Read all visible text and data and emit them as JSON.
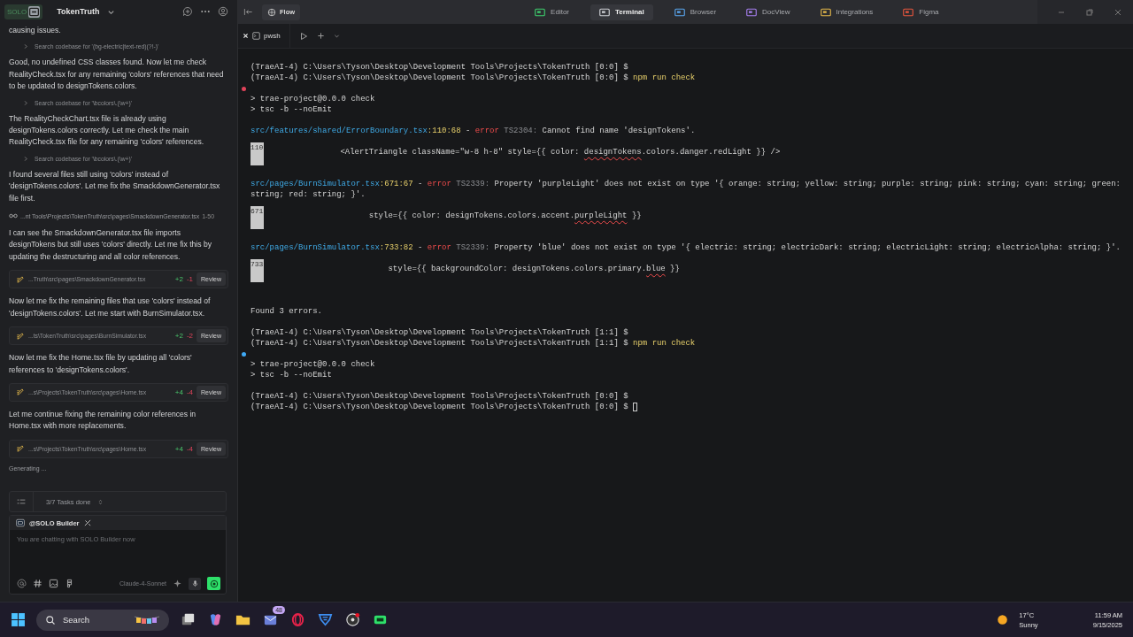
{
  "sidebar": {
    "logo": "SOLO",
    "project": "TokenTruth",
    "messages": [
      {
        "kind": "text",
        "text": "causing issues."
      },
      {
        "kind": "search",
        "text": "Search codebase for '(bg-electric|text-red)(?!-)'"
      },
      {
        "kind": "text",
        "text": "Good, no undefined CSS classes found. Now let me check RealityCheck.tsx for any remaining 'colors' references that need to be updated to designTokens.colors."
      },
      {
        "kind": "search",
        "text": "Search codebase for '\\bcolors\\.(\\w+)'"
      },
      {
        "kind": "text",
        "text": "The RealityCheckChart.tsx file is already using designTokens.colors correctly. Let me check the main RealityCheck.tsx file for any remaining 'colors' references."
      },
      {
        "kind": "search",
        "text": "Search codebase for '\\bcolors\\.(\\w+)'"
      },
      {
        "kind": "text",
        "text": "I found several files still using 'colors' instead of 'designTokens.colors'. Let me fix the SmackdownGenerator.tsx file first."
      },
      {
        "kind": "file",
        "path": "...nt Tools\\Projects\\TokenTruth\\src\\pages\\SmackdownGenerator.tsx",
        "range": "1-50"
      },
      {
        "kind": "text",
        "text": "I can see the SmackdownGenerator.tsx file imports designTokens but still uses 'colors' directly. Let me fix this by updating the destructuring and all color references."
      },
      {
        "kind": "edit",
        "path": "...Truth\\src\\pages\\SmackdownGenerator.tsx",
        "added": "+2",
        "removed": "-1",
        "action": "Review"
      },
      {
        "kind": "text",
        "text": "Now let me fix the remaining files that use 'colors' instead of 'designTokens.colors'. Let me start with BurnSimulator.tsx."
      },
      {
        "kind": "edit",
        "path": "...ts\\TokenTruth\\src\\pages\\BurnSimulator.tsx",
        "added": "+2",
        "removed": "-2",
        "action": "Review"
      },
      {
        "kind": "text",
        "text": "Now let me fix the Home.tsx file by updating all 'colors' references to 'designTokens.colors'."
      },
      {
        "kind": "edit",
        "path": "...s\\Projects\\TokenTruth\\src\\pages\\Home.tsx",
        "added": "+4",
        "removed": "-4",
        "action": "Review"
      },
      {
        "kind": "text",
        "text": "Let me continue fixing the remaining color references in Home.tsx with more replacements."
      },
      {
        "kind": "edit",
        "path": "...s\\Projects\\TokenTruth\\src\\pages\\Home.tsx",
        "added": "+4",
        "removed": "-4",
        "action": "Review"
      }
    ],
    "status": "Generating ...",
    "tasks": "3/7 Tasks done",
    "composer": {
      "agent": "@SOLO Builder",
      "placeholder": "You are chatting with SOLO Builder now",
      "model": "Claude-4-Sonnet"
    }
  },
  "topbar": {
    "flow": "Flow",
    "tabs": [
      {
        "label": "Editor",
        "selected": false
      },
      {
        "label": "Terminal",
        "selected": true
      },
      {
        "label": "Browser",
        "selected": false
      },
      {
        "label": "DocView",
        "selected": false
      },
      {
        "label": "Integrations",
        "selected": false
      },
      {
        "label": "Figma",
        "selected": false
      }
    ]
  },
  "terminal": {
    "tab": "pwsh",
    "lines": [
      {
        "kind": "prompt",
        "text": "(TraeAI-4) C:\\Users\\Tyson\\Desktop\\Development Tools\\Projects\\TokenTruth [0:0] $"
      },
      {
        "kind": "prompt",
        "text": "(TraeAI-4) C:\\Users\\Tyson\\Desktop\\Development Tools\\Projects\\TokenTruth [0:0] $",
        "command": "npm run check"
      },
      {
        "kind": "gap",
        "color": "#e0435a"
      },
      {
        "kind": "out",
        "text": "> trae-project@0.0.0 check"
      },
      {
        "kind": "out",
        "text": "> tsc -b --noEmit"
      },
      {
        "kind": "gap"
      },
      {
        "kind": "error",
        "file": "src/features/shared/ErrorBoundary.tsx",
        "loc": ":110:68",
        "separator": "-",
        "severity": "error",
        "code": "TS2304:",
        "message": "Cannot find name 'designTokens'."
      },
      {
        "kind": "gap"
      },
      {
        "kind": "code",
        "number": "110",
        "before": "                <AlertTriangle className=\"w-8 h-8\" style={{ color: ",
        "marked": "designTokens",
        "after": ".colors.danger.redLight }} />"
      },
      {
        "kind": "gap"
      },
      {
        "kind": "error",
        "file": "src/pages/BurnSimulator.tsx",
        "loc": ":671:67",
        "separator": "-",
        "severity": "error",
        "code": "TS2339:",
        "message": "Property 'purpleLight' does not exist on type '{ orange: string; yellow: string; purple: string; pink: string; cyan: string; green: string; red: string; }'."
      },
      {
        "kind": "gap"
      },
      {
        "kind": "code",
        "number": "671",
        "before": "                      style={{ color: designTokens.colors.accent.",
        "marked": "purpleLight",
        "after": " }}"
      },
      {
        "kind": "gap"
      },
      {
        "kind": "error",
        "file": "src/pages/BurnSimulator.tsx",
        "loc": ":733:82",
        "separator": "-",
        "severity": "error",
        "code": "TS2339:",
        "message": "Property 'blue' does not exist on type '{ electric: string; electricDark: string; electricLight: string; electricAlpha: string; }'."
      },
      {
        "kind": "gap"
      },
      {
        "kind": "code",
        "number": "733",
        "before": "                          style={{ backgroundColor: designTokens.colors.primary.",
        "marked": "blue",
        "after": " }}"
      },
      {
        "kind": "gap"
      },
      {
        "kind": "gap"
      },
      {
        "kind": "out",
        "text": "Found 3 errors."
      },
      {
        "kind": "gap"
      },
      {
        "kind": "prompt",
        "text": "(TraeAI-4) C:\\Users\\Tyson\\Desktop\\Development Tools\\Projects\\TokenTruth [1:1] $"
      },
      {
        "kind": "prompt",
        "text": "(TraeAI-4) C:\\Users\\Tyson\\Desktop\\Development Tools\\Projects\\TokenTruth [1:1] $",
        "command": "npm run check"
      },
      {
        "kind": "gap",
        "color": "#3fa9f5"
      },
      {
        "kind": "out",
        "text": "> trae-project@0.0.0 check"
      },
      {
        "kind": "out",
        "text": "> tsc -b --noEmit"
      },
      {
        "kind": "gap"
      },
      {
        "kind": "prompt",
        "text": "(TraeAI-4) C:\\Users\\Tyson\\Desktop\\Development Tools\\Projects\\TokenTruth [0:0] $"
      },
      {
        "kind": "prompt",
        "text": "(TraeAI-4) C:\\Users\\Tyson\\Desktop\\Development Tools\\Projects\\TokenTruth [0:0] $",
        "cursor": true
      }
    ]
  },
  "taskbar": {
    "search": "Search",
    "mail_badge": "48",
    "weather": {
      "temp": "17°C",
      "condition": "Sunny"
    },
    "clock": {
      "time": "11:59 AM",
      "date": "9/15/2025"
    }
  }
}
